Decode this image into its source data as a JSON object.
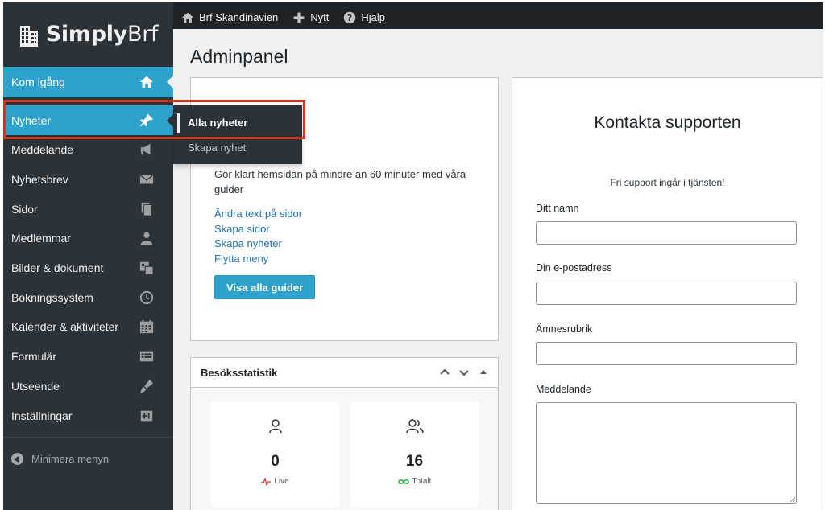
{
  "brand": {
    "name_bold": "Simply",
    "name_light": "Brf"
  },
  "adminbar": {
    "items": [
      {
        "label": "Brf Skandinavien",
        "icon": "home-icon"
      },
      {
        "label": "Nytt",
        "icon": "plus-icon"
      },
      {
        "label": "Hjälp",
        "icon": "help-icon"
      }
    ]
  },
  "sidebar": {
    "items": [
      {
        "label": "Kom igång",
        "icon": "home-icon",
        "active": true
      },
      {
        "label": "Nyheter",
        "icon": "pin-icon",
        "active": true
      },
      {
        "label": "Meddelande",
        "icon": "megaphone-icon"
      },
      {
        "label": "Nyhetsbrev",
        "icon": "envelope-icon"
      },
      {
        "label": "Sidor",
        "icon": "pages-icon"
      },
      {
        "label": "Medlemmar",
        "icon": "user-icon"
      },
      {
        "label": "Bilder & dokument",
        "icon": "media-icon"
      },
      {
        "label": "Bokningssystem",
        "icon": "clock-icon"
      },
      {
        "label": "Kalender & aktiviteter",
        "icon": "calendar-icon"
      },
      {
        "label": "Formulär",
        "icon": "form-icon"
      },
      {
        "label": "Utseende",
        "icon": "brush-icon"
      },
      {
        "label": "Inställningar",
        "icon": "settings-icon"
      }
    ],
    "collapse_label": "Minimera menyn",
    "flyout": {
      "items": [
        "Alla nyheter",
        "Skapa nyhet"
      ]
    }
  },
  "main": {
    "page_title": "Adminpanel",
    "guides": {
      "description": "Gör klart hemsidan på mindre än 60 minuter med våra guider",
      "links": [
        "Ändra text på sidor",
        "Skapa sidor",
        "Skapa nyheter",
        "Flytta meny"
      ],
      "button_label": "Visa alla guider"
    },
    "stats": {
      "title": "Besöksstatistik",
      "cards": [
        {
          "value": "0",
          "label": "Live",
          "icon": "user-icon"
        },
        {
          "value": "16",
          "label": "Totalt",
          "icon": "users-icon"
        }
      ]
    },
    "support": {
      "title": "Kontakta supporten",
      "subtitle": "Fri support ingår i tjänsten!",
      "fields": [
        {
          "label": "Ditt namn",
          "value": ""
        },
        {
          "label": "Din e-postadress",
          "value": ""
        },
        {
          "label": "Ämnesrubrik",
          "value": ""
        },
        {
          "label": "Meddelande",
          "value": ""
        }
      ]
    }
  },
  "colors": {
    "accent": "#2ea2cc",
    "sidebar_bg": "#2c3338",
    "adminbar_bg": "#1d2327",
    "link": "#2271b1",
    "highlight": "#d2351b"
  }
}
